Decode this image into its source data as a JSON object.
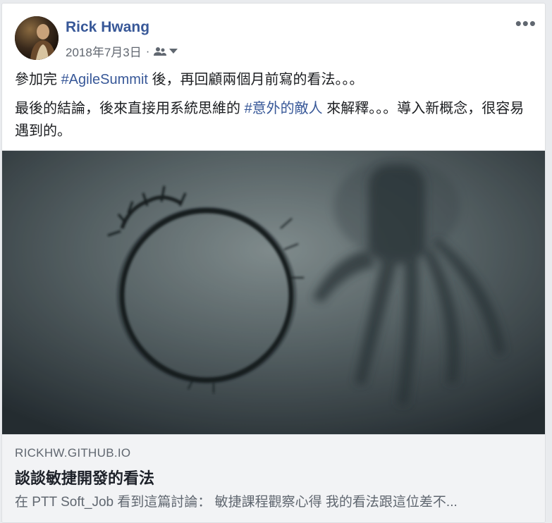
{
  "post": {
    "author": "Rick Hwang",
    "date": "2018年7月3日",
    "separator": "·",
    "audience_icon": "friends-icon",
    "more_label": "•••",
    "line1": {
      "pre": "參加完 ",
      "tag": "#AgileSummit",
      "post": " 後，再回顧兩個月前寫的看法。。。"
    },
    "line2": {
      "pre": "最後的結論，後來直接用系統思維的 ",
      "tag": "#意外的敵人",
      "post": " 來解釋。。。導入新概念，很容易遇到的。"
    }
  },
  "link": {
    "domain": "RICKHW.GITHUB.IO",
    "title": "談談敏捷開發的看法",
    "description": "在 PTT Soft_Job 看到這篇討論： 敏捷課程觀察心得 我的看法跟這位差不..."
  },
  "colors": {
    "link_blue": "#385898",
    "text": "#1c1e21",
    "muted": "#606770",
    "link_box_bg": "#f2f3f5"
  }
}
